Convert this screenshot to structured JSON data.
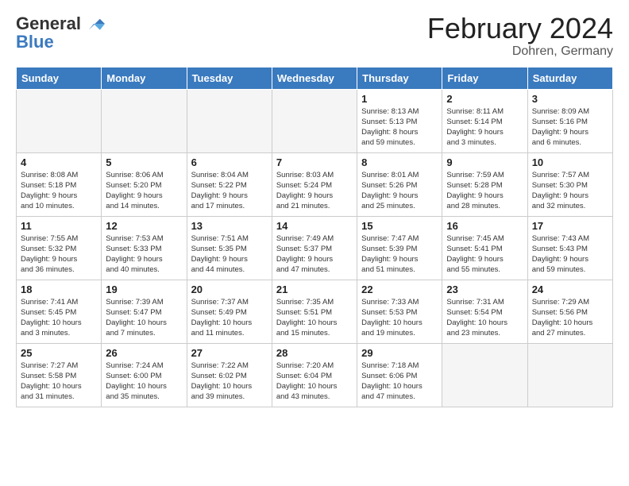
{
  "header": {
    "logo_general": "General",
    "logo_blue": "Blue",
    "title": "February 2024",
    "subtitle": "Dohren, Germany"
  },
  "weekdays": [
    "Sunday",
    "Monday",
    "Tuesday",
    "Wednesday",
    "Thursday",
    "Friday",
    "Saturday"
  ],
  "weeks": [
    [
      {
        "day": "",
        "info": ""
      },
      {
        "day": "",
        "info": ""
      },
      {
        "day": "",
        "info": ""
      },
      {
        "day": "",
        "info": ""
      },
      {
        "day": "1",
        "info": "Sunrise: 8:13 AM\nSunset: 5:13 PM\nDaylight: 8 hours\nand 59 minutes."
      },
      {
        "day": "2",
        "info": "Sunrise: 8:11 AM\nSunset: 5:14 PM\nDaylight: 9 hours\nand 3 minutes."
      },
      {
        "day": "3",
        "info": "Sunrise: 8:09 AM\nSunset: 5:16 PM\nDaylight: 9 hours\nand 6 minutes."
      }
    ],
    [
      {
        "day": "4",
        "info": "Sunrise: 8:08 AM\nSunset: 5:18 PM\nDaylight: 9 hours\nand 10 minutes."
      },
      {
        "day": "5",
        "info": "Sunrise: 8:06 AM\nSunset: 5:20 PM\nDaylight: 9 hours\nand 14 minutes."
      },
      {
        "day": "6",
        "info": "Sunrise: 8:04 AM\nSunset: 5:22 PM\nDaylight: 9 hours\nand 17 minutes."
      },
      {
        "day": "7",
        "info": "Sunrise: 8:03 AM\nSunset: 5:24 PM\nDaylight: 9 hours\nand 21 minutes."
      },
      {
        "day": "8",
        "info": "Sunrise: 8:01 AM\nSunset: 5:26 PM\nDaylight: 9 hours\nand 25 minutes."
      },
      {
        "day": "9",
        "info": "Sunrise: 7:59 AM\nSunset: 5:28 PM\nDaylight: 9 hours\nand 28 minutes."
      },
      {
        "day": "10",
        "info": "Sunrise: 7:57 AM\nSunset: 5:30 PM\nDaylight: 9 hours\nand 32 minutes."
      }
    ],
    [
      {
        "day": "11",
        "info": "Sunrise: 7:55 AM\nSunset: 5:32 PM\nDaylight: 9 hours\nand 36 minutes."
      },
      {
        "day": "12",
        "info": "Sunrise: 7:53 AM\nSunset: 5:33 PM\nDaylight: 9 hours\nand 40 minutes."
      },
      {
        "day": "13",
        "info": "Sunrise: 7:51 AM\nSunset: 5:35 PM\nDaylight: 9 hours\nand 44 minutes."
      },
      {
        "day": "14",
        "info": "Sunrise: 7:49 AM\nSunset: 5:37 PM\nDaylight: 9 hours\nand 47 minutes."
      },
      {
        "day": "15",
        "info": "Sunrise: 7:47 AM\nSunset: 5:39 PM\nDaylight: 9 hours\nand 51 minutes."
      },
      {
        "day": "16",
        "info": "Sunrise: 7:45 AM\nSunset: 5:41 PM\nDaylight: 9 hours\nand 55 minutes."
      },
      {
        "day": "17",
        "info": "Sunrise: 7:43 AM\nSunset: 5:43 PM\nDaylight: 9 hours\nand 59 minutes."
      }
    ],
    [
      {
        "day": "18",
        "info": "Sunrise: 7:41 AM\nSunset: 5:45 PM\nDaylight: 10 hours\nand 3 minutes."
      },
      {
        "day": "19",
        "info": "Sunrise: 7:39 AM\nSunset: 5:47 PM\nDaylight: 10 hours\nand 7 minutes."
      },
      {
        "day": "20",
        "info": "Sunrise: 7:37 AM\nSunset: 5:49 PM\nDaylight: 10 hours\nand 11 minutes."
      },
      {
        "day": "21",
        "info": "Sunrise: 7:35 AM\nSunset: 5:51 PM\nDaylight: 10 hours\nand 15 minutes."
      },
      {
        "day": "22",
        "info": "Sunrise: 7:33 AM\nSunset: 5:53 PM\nDaylight: 10 hours\nand 19 minutes."
      },
      {
        "day": "23",
        "info": "Sunrise: 7:31 AM\nSunset: 5:54 PM\nDaylight: 10 hours\nand 23 minutes."
      },
      {
        "day": "24",
        "info": "Sunrise: 7:29 AM\nSunset: 5:56 PM\nDaylight: 10 hours\nand 27 minutes."
      }
    ],
    [
      {
        "day": "25",
        "info": "Sunrise: 7:27 AM\nSunset: 5:58 PM\nDaylight: 10 hours\nand 31 minutes."
      },
      {
        "day": "26",
        "info": "Sunrise: 7:24 AM\nSunset: 6:00 PM\nDaylight: 10 hours\nand 35 minutes."
      },
      {
        "day": "27",
        "info": "Sunrise: 7:22 AM\nSunset: 6:02 PM\nDaylight: 10 hours\nand 39 minutes."
      },
      {
        "day": "28",
        "info": "Sunrise: 7:20 AM\nSunset: 6:04 PM\nDaylight: 10 hours\nand 43 minutes."
      },
      {
        "day": "29",
        "info": "Sunrise: 7:18 AM\nSunset: 6:06 PM\nDaylight: 10 hours\nand 47 minutes."
      },
      {
        "day": "",
        "info": ""
      },
      {
        "day": "",
        "info": ""
      }
    ]
  ]
}
